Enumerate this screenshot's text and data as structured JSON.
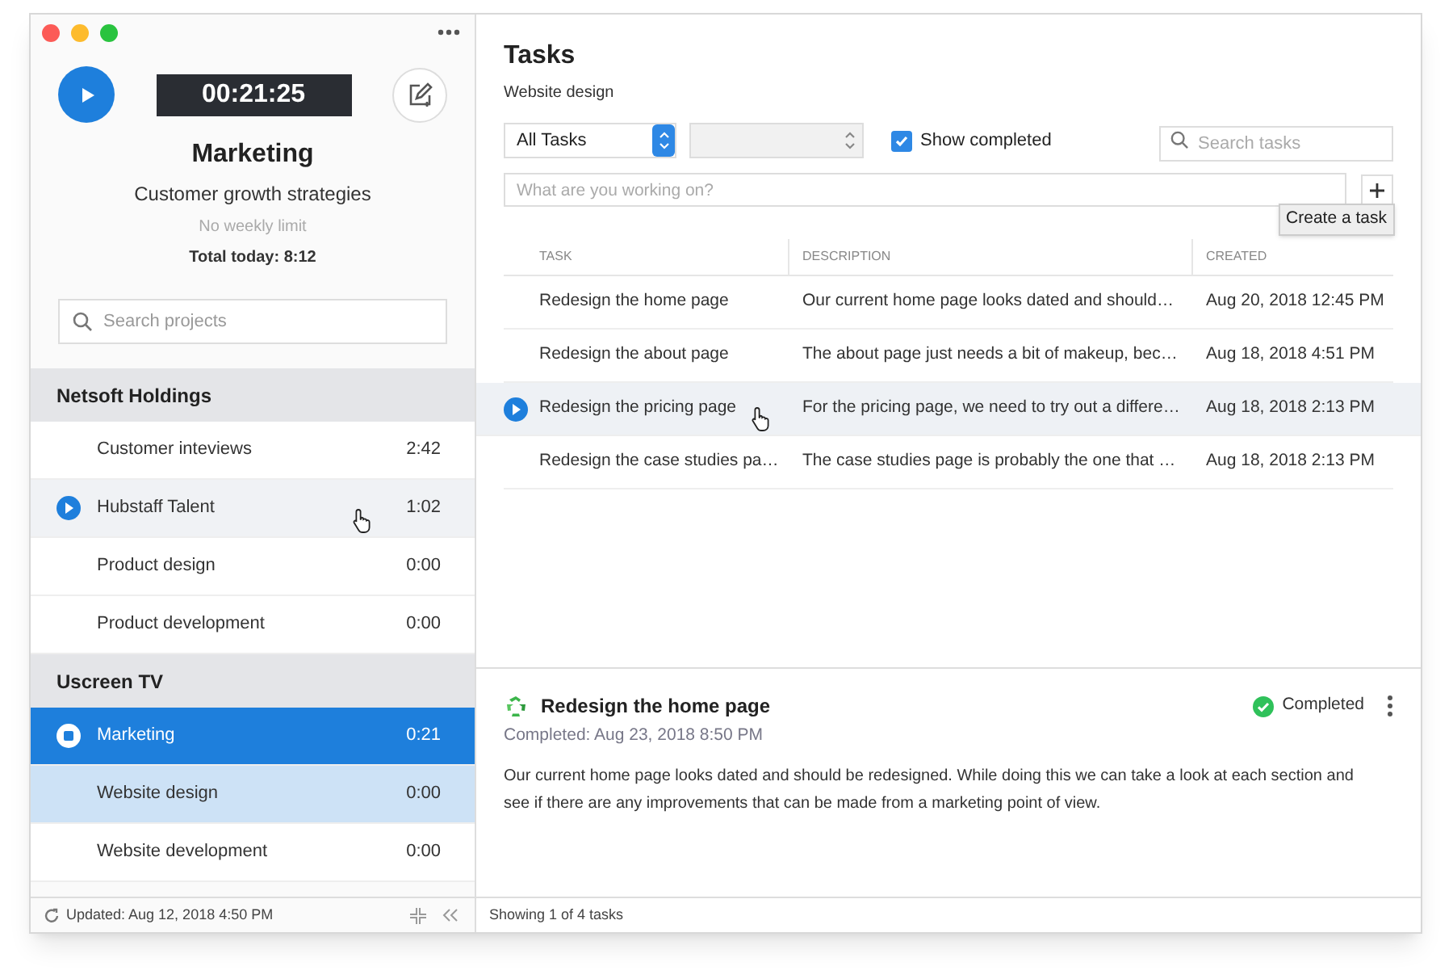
{
  "timer": {
    "time": "00:21:25",
    "project": "Marketing",
    "task": "Customer growth strategies",
    "limit": "No weekly limit",
    "total": "Total today: 8:12"
  },
  "project_search": {
    "placeholder": "Search projects"
  },
  "groups": [
    {
      "name": "Netsoft Holdings",
      "items": [
        {
          "name": "Customer inteviews",
          "time": "2:42",
          "selected": false,
          "kind": "idle"
        },
        {
          "name": "Hubstaff Talent",
          "time": "1:02",
          "selected": false,
          "kind": "hover"
        },
        {
          "name": "Product design",
          "time": "0:00",
          "selected": false,
          "kind": "idle"
        },
        {
          "name": "Product development",
          "time": "0:00",
          "selected": false,
          "kind": "idle"
        }
      ]
    },
    {
      "name": "Uscreen TV",
      "items": [
        {
          "name": "Marketing",
          "time": "0:21",
          "selected": false,
          "kind": "running"
        },
        {
          "name": "Website design",
          "time": "0:00",
          "selected": true,
          "kind": "idle"
        },
        {
          "name": "Website development",
          "time": "0:00",
          "selected": false,
          "kind": "idle"
        }
      ]
    }
  ],
  "sidebar_status": "Updated: Aug 12, 2018 4:50 PM",
  "header": {
    "title": "Tasks",
    "subtitle": "Website design"
  },
  "filter": {
    "value": "All Tasks"
  },
  "show_completed": {
    "label": "Show completed",
    "checked": true
  },
  "task_search": {
    "placeholder": "Search tasks"
  },
  "new_task": {
    "placeholder": "What are you working on?"
  },
  "tooltip": "Create a task",
  "table": {
    "columns": [
      "TASK",
      "DESCRIPTION",
      "CREATED"
    ],
    "rows": [
      {
        "task": "Redesign the home page",
        "description": "Our current home page looks dated and should…",
        "created": "Aug 20, 2018 12:45 PM",
        "hovered": false
      },
      {
        "task": "Redesign the about page",
        "description": "The about page just needs a bit of makeup, bec…",
        "created": "Aug 18, 2018 4:51 PM",
        "hovered": false
      },
      {
        "task": "Redesign the pricing page",
        "description": "For the pricing page, we need to try out a differe…",
        "created": "Aug 18, 2018 2:13 PM",
        "hovered": true
      },
      {
        "task": "Redesign the case studies pa…",
        "description": "The case studies page is probably the one that …",
        "created": "Aug 18, 2018 2:13 PM",
        "hovered": false
      }
    ]
  },
  "detail": {
    "title": "Redesign the home page",
    "completed_at": "Completed: Aug 23, 2018 8:50 PM",
    "status": "Completed",
    "completed": true,
    "description": "Our current home page looks dated and should be redesigned. While doing this we can take a look at each section and see if there are any improvements that can be made from a marketing point of view."
  },
  "status_bar": "Showing 1 of 4 tasks"
}
